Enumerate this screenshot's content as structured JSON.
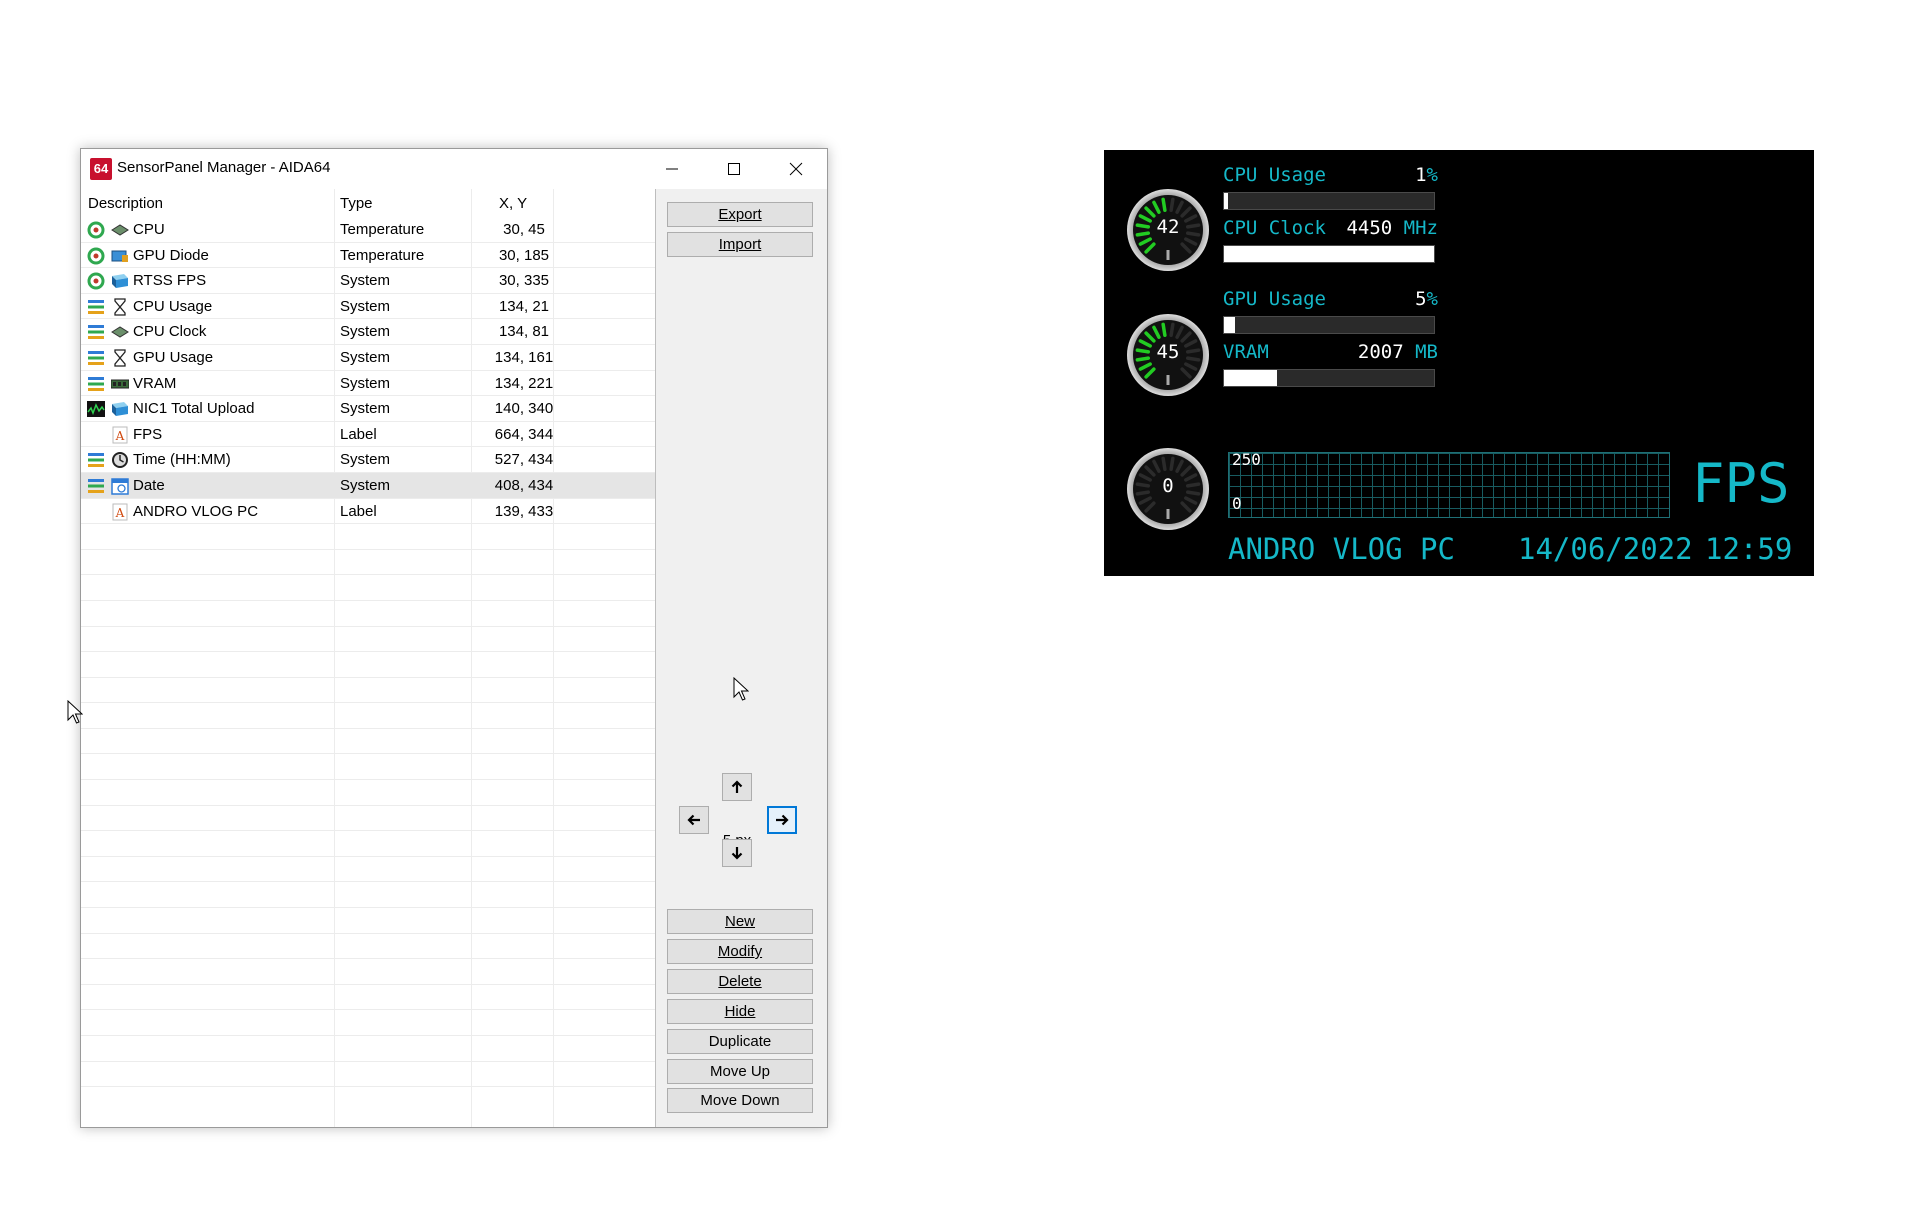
{
  "window": {
    "title": "SensorPanel Manager - AIDA64",
    "app_icon_text": "64"
  },
  "table": {
    "headers": [
      "Description",
      "Type",
      "X, Y"
    ],
    "rows": [
      {
        "description": "CPU",
        "type": "Temperature",
        "xy": "30, 45",
        "icon": "gauge-icon",
        "icon2": "cpu-chip-icon"
      },
      {
        "description": "GPU Diode",
        "type": "Temperature",
        "xy": "30, 185",
        "icon": "gauge-icon",
        "icon2": "gpu-icon"
      },
      {
        "description": "RTSS FPS",
        "type": "System",
        "xy": "30, 335",
        "icon": "gauge-icon",
        "icon2": "monitor-icon"
      },
      {
        "description": "CPU Usage",
        "type": "System",
        "xy": "134, 21",
        "icon": "bar-icon",
        "icon2": "hourglass-icon"
      },
      {
        "description": "CPU Clock",
        "type": "System",
        "xy": "134, 81",
        "icon": "bar-icon",
        "icon2": "cpu-chip-icon"
      },
      {
        "description": "GPU Usage",
        "type": "System",
        "xy": "134, 161",
        "icon": "bar-icon",
        "icon2": "hourglass-icon"
      },
      {
        "description": "VRAM",
        "type": "System",
        "xy": "134, 221",
        "icon": "bar-icon",
        "icon2": "memory-icon"
      },
      {
        "description": "NIC1 Total Upload",
        "type": "System",
        "xy": "140, 340",
        "icon": "graph-icon",
        "icon2": "network-icon"
      },
      {
        "description": "FPS",
        "type": "Label",
        "xy": "664, 344",
        "icon": "",
        "icon2": "label-icon"
      },
      {
        "description": "Time (HH:MM)",
        "type": "System",
        "xy": "527, 434",
        "icon": "bar-icon",
        "icon2": "clock-icon"
      },
      {
        "description": "Date",
        "type": "System",
        "xy": "408, 434",
        "icon": "bar-icon",
        "icon2": "calendar-icon"
      },
      {
        "description": "ANDRO VLOG PC",
        "type": "Label",
        "xy": "139, 433",
        "icon": "",
        "icon2": "label-icon"
      }
    ],
    "selected_row": 10
  },
  "buttons": {
    "export": "Export",
    "import": "Import",
    "new": "New",
    "modify": "Modify",
    "delete": "Delete",
    "hide": "Hide",
    "duplicate": "Duplicate",
    "move_up": "Move Up",
    "move_down": "Move Down"
  },
  "nudge": {
    "step": "5 px"
  },
  "panel": {
    "cpu_usage_label": "CPU Usage",
    "cpu_usage_value": "1",
    "cpu_usage_unit": "%",
    "cpu_usage_fraction": 0.01,
    "cpu_clock_label": "CPU Clock",
    "cpu_clock_value": "4450",
    "cpu_clock_unit": "MHz",
    "cpu_clock_fraction": 1.0,
    "gpu_usage_label": "GPU Usage",
    "gpu_usage_value": "5",
    "gpu_usage_unit": "%",
    "gpu_usage_fraction": 0.05,
    "vram_label": "VRAM",
    "vram_value": "2007",
    "vram_unit": "MB",
    "vram_fraction": 0.25,
    "cpu_temp_gauge": "42",
    "gpu_temp_gauge": "45",
    "fps_gauge": "0",
    "graph_max": "250",
    "graph_min": "0",
    "fps_text": "FPS",
    "pc_name": "ANDRO VLOG PC",
    "date": "14/06/2022",
    "time": "12:59",
    "accent_color": "#15b8c8",
    "gauge_green": "#22cc22"
  }
}
